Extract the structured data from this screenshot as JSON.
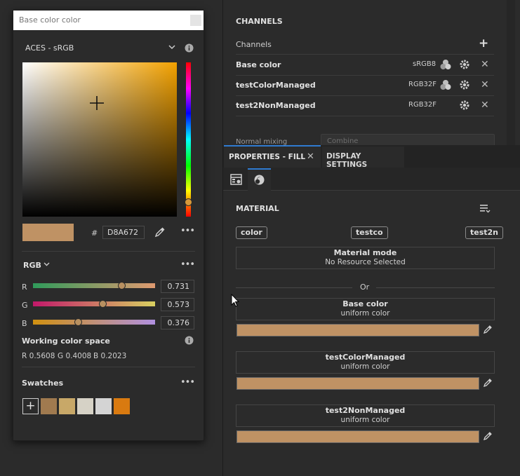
{
  "picker": {
    "title": "Base color color",
    "colorspace": "ACES - sRGB",
    "hex_label": "#",
    "hex_value": "D8A672",
    "current_color": "#bf9264",
    "mode": "RGB",
    "sliders": [
      {
        "label": "R",
        "value": "0.731",
        "fraction": 0.731
      },
      {
        "label": "G",
        "value": "0.573",
        "fraction": 0.573
      },
      {
        "label": "B",
        "value": "0.376",
        "fraction": 0.376
      }
    ],
    "working_title": "Working color space",
    "working_r": "R 0.5608",
    "working_g": "G 0.4008",
    "working_b": "B 0.2023",
    "swatches_title": "Swatches",
    "swatches": [
      "#a07a4f",
      "#c8a868",
      "#d6d2c6",
      "#d4d4d4",
      "#d97a10"
    ]
  },
  "channels": {
    "title": "CHANNELS",
    "header": "Channels",
    "items": [
      {
        "name": "Base color",
        "format": "sRGB8"
      },
      {
        "name": "testColorManaged",
        "format": "RGB32F"
      },
      {
        "name": "test2NonManaged",
        "format": "RGB32F"
      }
    ],
    "normal_mixing_label": "Normal mixing",
    "normal_mixing_value": "Combine"
  },
  "tabs": {
    "properties": "PROPERTIES - FILL",
    "display": "DISPLAY SETTINGS"
  },
  "material": {
    "title": "MATERIAL",
    "chips": [
      "color",
      "testco",
      "test2n"
    ],
    "mode_title": "Material mode",
    "mode_sub": "No Resource Selected",
    "or_label": "Or",
    "slots": [
      {
        "title": "Base color",
        "sub": "uniform color"
      },
      {
        "title": "testColorManaged",
        "sub": "uniform color"
      },
      {
        "title": "test2NonManaged",
        "sub": "uniform color"
      }
    ]
  },
  "colors": {
    "accent": "#2f7bd1",
    "panel": "#2b2b2b",
    "swatch": "#bf9264"
  }
}
